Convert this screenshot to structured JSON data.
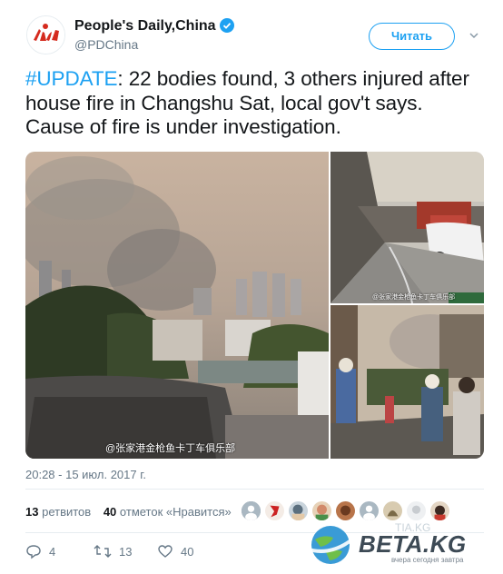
{
  "account": {
    "name": "People's Daily,China",
    "handle": "@PDChina",
    "follow_label": "Читать"
  },
  "tweet": {
    "hashtag": "#UPDATE",
    "text": ": 22 bodies found, 3 others injured after house fire in Changshu Sat, local gov't says. Cause of fire is under investigation.",
    "photo_watermark_main": "@张家港金枪鱼卡丁车俱乐部",
    "photo_watermark_small": "@张家港金枪鱼卡丁车俱乐部",
    "timestamp": "20:28 - 15 июл. 2017 г."
  },
  "stats": {
    "retweets_count": "13",
    "retweets_label": "ретвитов",
    "likes_count": "40",
    "likes_label": "отметок «Нравится»"
  },
  "actions": {
    "replies": "4",
    "retweets": "13",
    "likes": "40"
  },
  "overlay": {
    "brand": "BETA.KG",
    "tagline": "вчера сегодня завтра",
    "faint": "TIA.KG"
  },
  "colors": {
    "accent": "#1da1f2",
    "text": "#14171a",
    "muted": "#657786"
  }
}
